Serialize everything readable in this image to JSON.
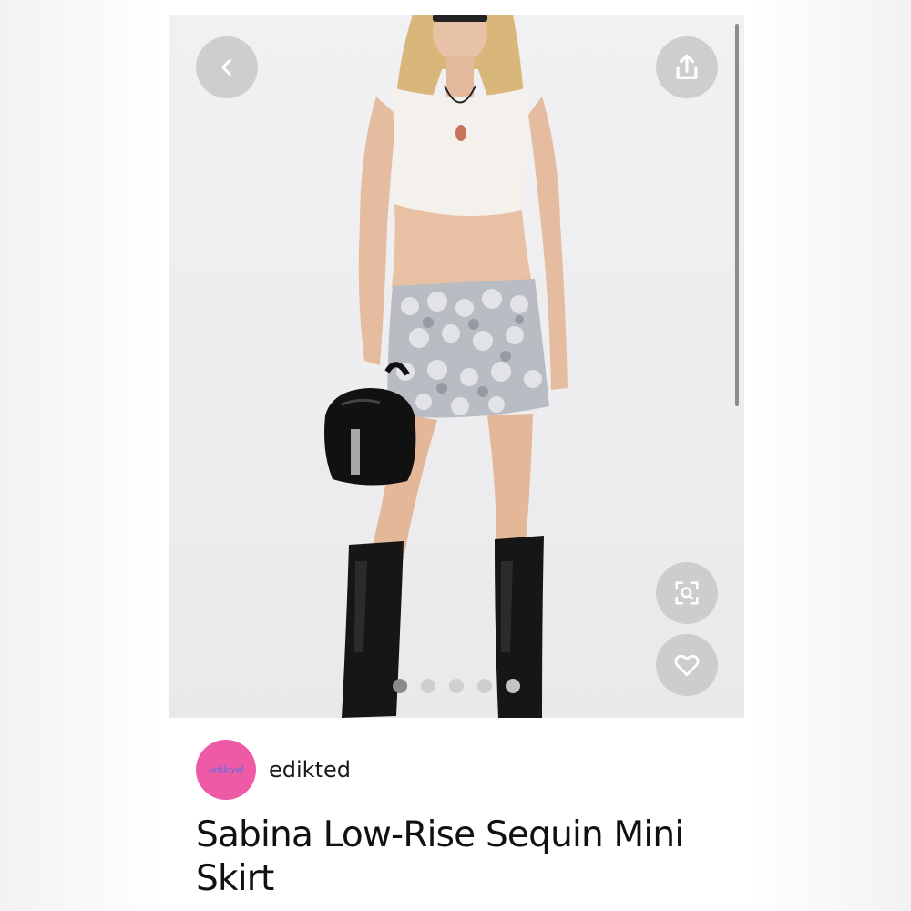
{
  "product": {
    "brand": "edikted",
    "brand_logo_text": "edikted",
    "title": "Sabina Low-Rise Sequin Mini Skirt"
  },
  "actions": {
    "back_icon": "chevron-left-icon",
    "share_icon": "share-upload-icon",
    "visual_search_icon": "visual-search-icon",
    "like_icon": "heart-icon"
  },
  "gallery": {
    "total_images": 5,
    "active_index": 1
  },
  "colors": {
    "brand_avatar": "#ee5aa6",
    "action_button_bg": "#c8c8ca",
    "active_dot": "#8a8a8c"
  }
}
